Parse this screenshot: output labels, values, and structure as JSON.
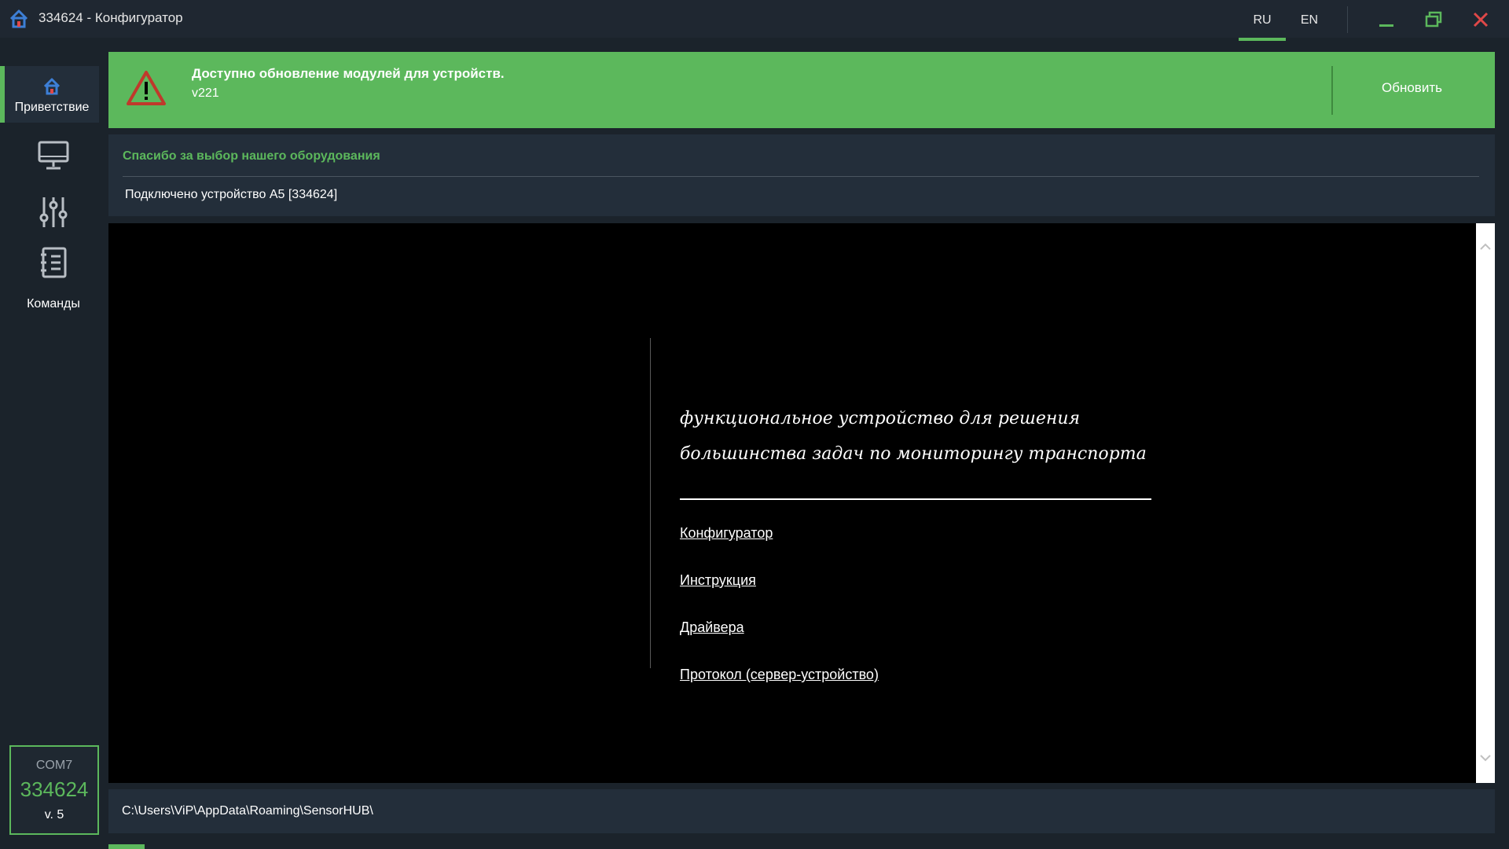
{
  "window": {
    "title": "334624 - Конфигуратор",
    "languages": [
      "RU",
      "EN"
    ],
    "active_language": "RU"
  },
  "sidebar": {
    "items": [
      {
        "label": "Приветствие",
        "icon": "home-icon",
        "active": true
      },
      {
        "label": "",
        "icon": "monitor-icon"
      },
      {
        "label": "",
        "icon": "sliders-icon"
      },
      {
        "label": "Команды",
        "icon": "notebook-icon"
      }
    ],
    "device": {
      "port": "COM7",
      "id": "334624",
      "version": "v. 5"
    }
  },
  "banner": {
    "title": "Доступно обновление модулей для устройств.",
    "version": "v221",
    "button": "Обновить",
    "icon": "warning-icon"
  },
  "info": {
    "title": "Спасибо за выбор нашего оборудования",
    "text": "Подключено устройство A5 [334624]"
  },
  "viewer": {
    "tagline_line1": "функциональное устройство для решения",
    "tagline_line2": "большинства задач по мониторингу транспорта",
    "links": [
      "Конфигуратор",
      "Инструкция",
      "Драйвера",
      "Протокол (сервер-устройство)"
    ]
  },
  "path": "C:\\Users\\ViP\\AppData\\Roaming\\SensorHUB\\",
  "colors": {
    "accent": "#5cb85c",
    "background": "#1b232b",
    "panel": "#232e3a",
    "close": "#e04848"
  }
}
